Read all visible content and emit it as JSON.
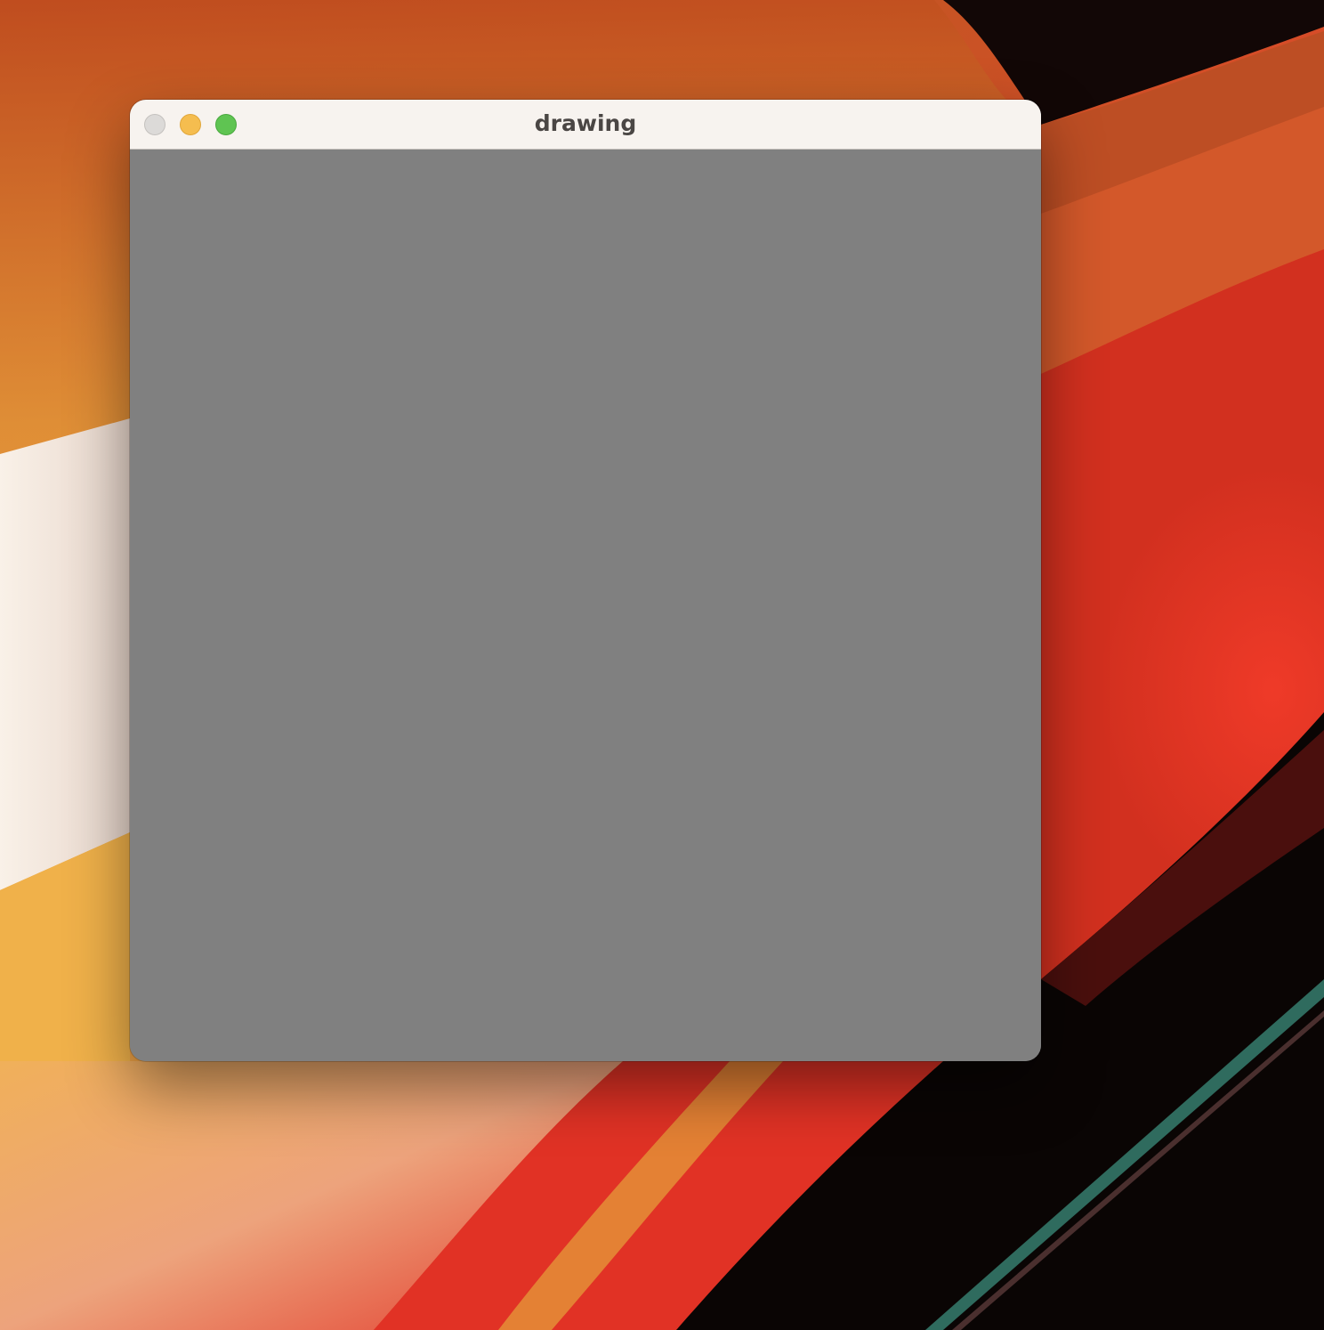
{
  "window": {
    "title": "drawing",
    "canvas_color": "#808080",
    "traffic_lights": {
      "close_color": "#dcdad8",
      "minimize_color": "#f5bd4f",
      "zoom_color": "#5fc452"
    }
  },
  "wallpaper": {
    "colors": [
      "#b8361c",
      "#e8632c",
      "#f2b14a",
      "#e2302a",
      "#f8efe6",
      "#0c0806",
      "#2f6b5e"
    ]
  }
}
